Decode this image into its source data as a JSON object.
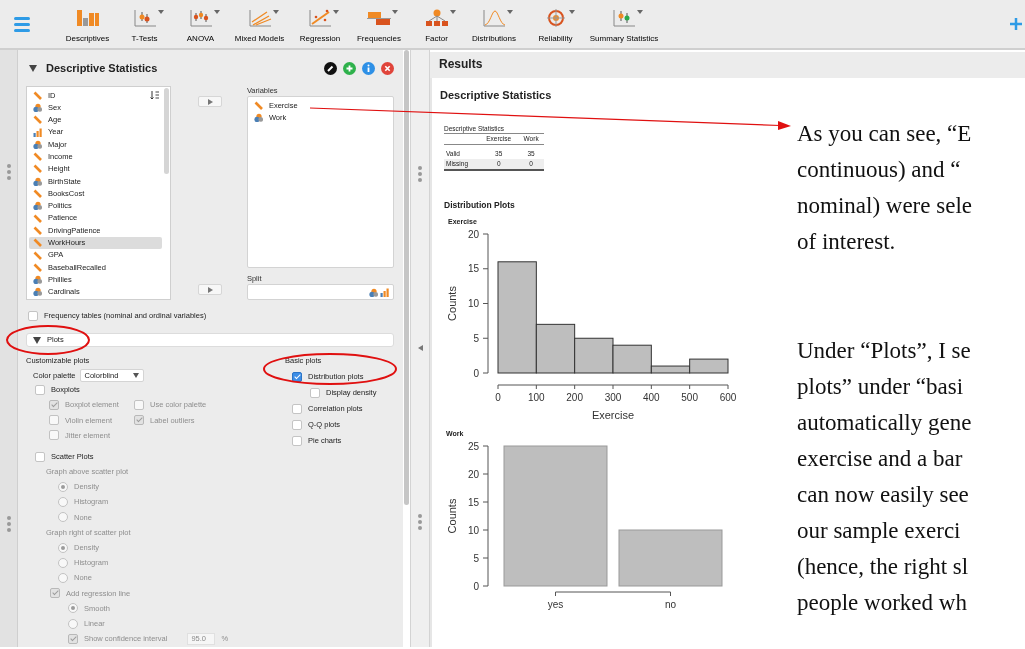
{
  "toolbar": {
    "items": [
      {
        "label": "Descriptives",
        "dropdown": false
      },
      {
        "label": "T-Tests",
        "dropdown": true
      },
      {
        "label": "ANOVA",
        "dropdown": true
      },
      {
        "label": "Mixed Models",
        "dropdown": true
      },
      {
        "label": "Regression",
        "dropdown": true
      },
      {
        "label": "Frequencies",
        "dropdown": true
      },
      {
        "label": "Factor",
        "dropdown": true
      },
      {
        "label": "Distributions",
        "dropdown": true
      },
      {
        "label": "Reliability",
        "dropdown": true
      },
      {
        "label": "Summary Statistics",
        "dropdown": true
      }
    ]
  },
  "analysis": {
    "title": "Descriptive Statistics",
    "expanded": true,
    "available_variables": [
      {
        "name": "ID",
        "kind": "scale",
        "selected": false
      },
      {
        "name": "Sex",
        "kind": "nominal",
        "selected": false
      },
      {
        "name": "Age",
        "kind": "scale",
        "selected": false
      },
      {
        "name": "Year",
        "kind": "ordinal",
        "selected": false
      },
      {
        "name": "Major",
        "kind": "nominal",
        "selected": false
      },
      {
        "name": "Income",
        "kind": "scale",
        "selected": false
      },
      {
        "name": "Height",
        "kind": "scale",
        "selected": false
      },
      {
        "name": "BirthState",
        "kind": "nominal",
        "selected": false
      },
      {
        "name": "BooksCost",
        "kind": "scale",
        "selected": false
      },
      {
        "name": "Politics",
        "kind": "nominal",
        "selected": false
      },
      {
        "name": "Patience",
        "kind": "scale",
        "selected": false
      },
      {
        "name": "DrivingPatience",
        "kind": "scale",
        "selected": false
      },
      {
        "name": "WorkHours",
        "kind": "scale",
        "selected": true
      },
      {
        "name": "GPA",
        "kind": "scale",
        "selected": false
      },
      {
        "name": "BaseballRecalled",
        "kind": "scale",
        "selected": false
      },
      {
        "name": "Phillies",
        "kind": "nominal",
        "selected": false
      },
      {
        "name": "Cardinals",
        "kind": "nominal",
        "selected": false
      }
    ],
    "variables_label": "Variables",
    "variables": [
      {
        "name": "Exercise",
        "kind": "scale"
      },
      {
        "name": "Work",
        "kind": "nominal"
      }
    ],
    "split_label": "Split",
    "frequency_tables": {
      "label": "Frequency tables (nominal and ordinal variables)",
      "checked": false
    },
    "plots_section": {
      "title": "Plots",
      "expanded": true
    },
    "customizable_title": "Customizable plots",
    "color_palette": {
      "label": "Color palette",
      "value": "Colorblind"
    },
    "boxplots": {
      "label": "Boxplots",
      "checked": false,
      "options": [
        {
          "label": "Boxplot element",
          "checked": true,
          "disabled": true
        },
        {
          "label": "Use color palette",
          "checked": false,
          "disabled": true
        },
        {
          "label": "Violin element",
          "checked": false,
          "disabled": true
        },
        {
          "label": "Label outliers",
          "checked": true,
          "disabled": true
        },
        {
          "label": "Jitter element",
          "checked": false,
          "disabled": true
        }
      ]
    },
    "scatter": {
      "label": "Scatter Plots",
      "checked": false,
      "groups": [
        {
          "label": "Graph above scatter plot",
          "disabled": true,
          "options": [
            {
              "label": "Density",
              "selected": true,
              "disabled": true
            },
            {
              "label": "Histogram",
              "selected": false,
              "disabled": true
            },
            {
              "label": "None",
              "selected": false,
              "disabled": true
            }
          ]
        },
        {
          "label": "Graph right of scatter plot",
          "disabled": true,
          "options": [
            {
              "label": "Density",
              "selected": true,
              "disabled": true
            },
            {
              "label": "Histogram",
              "selected": false,
              "disabled": true
            },
            {
              "label": "None",
              "selected": false,
              "disabled": true
            }
          ]
        }
      ],
      "regression": {
        "label": "Add regression line",
        "checked": true,
        "disabled": true,
        "options": [
          {
            "label": "Smooth",
            "selected": true,
            "disabled": true
          },
          {
            "label": "Linear",
            "selected": false,
            "disabled": true
          }
        ],
        "confidence": {
          "label": "Show confidence interval",
          "checked": true,
          "disabled": true,
          "value": "95.0",
          "unit": "%"
        }
      }
    },
    "basic_title": "Basic plots",
    "basic_plots": [
      {
        "label": "Distribution plots",
        "checked": true,
        "children": [
          {
            "label": "Display density",
            "checked": false
          }
        ]
      },
      {
        "label": "Correlation plots",
        "checked": false
      },
      {
        "label": "Q-Q plots",
        "checked": false
      },
      {
        "label": "Pie charts",
        "checked": false
      }
    ]
  },
  "results": {
    "title": "Results",
    "analysis_title": "Descriptive Statistics",
    "table": {
      "title": "Descriptive Statistics",
      "columns": [
        "Exercise",
        "Work"
      ],
      "rows": [
        {
          "label": "Valid",
          "values": [
            "35",
            "35"
          ]
        },
        {
          "label": "Missing",
          "values": [
            "0",
            "0"
          ]
        }
      ]
    },
    "plots_title": "Distribution Plots",
    "plots": [
      {
        "title": "Exercise",
        "chart_data": {
          "type": "bar",
          "x": [
            50,
            150,
            250,
            350,
            450,
            550
          ],
          "values": [
            16,
            7,
            5,
            4,
            1,
            2
          ],
          "xlabel": "Exercise",
          "ylabel": "Counts",
          "xlim": [
            0,
            600
          ],
          "ylim": [
            0,
            20
          ],
          "xticks": [
            0,
            100,
            200,
            300,
            400,
            500,
            600
          ],
          "yticks": [
            0,
            5,
            10,
            15,
            20
          ]
        }
      },
      {
        "title": "Work",
        "chart_data": {
          "type": "bar",
          "categories": [
            "yes",
            "no"
          ],
          "values": [
            25,
            10
          ],
          "ylabel": "Counts",
          "ylim": [
            0,
            25
          ],
          "yticks": [
            0,
            5,
            10,
            15,
            20,
            25
          ]
        }
      }
    ]
  },
  "annotation": {
    "paragraphs": [
      [
        "As you can see, “E",
        "continuous) and “",
        "nominal) were sele",
        "of interest."
      ],
      [
        "Under “Plots”, I se",
        "plots” under “basi",
        "automatically gene",
        "exercise and a bar",
        "can now easily see",
        "our sample exerci",
        "(hence, the right sl",
        "people worked wh"
      ]
    ]
  }
}
